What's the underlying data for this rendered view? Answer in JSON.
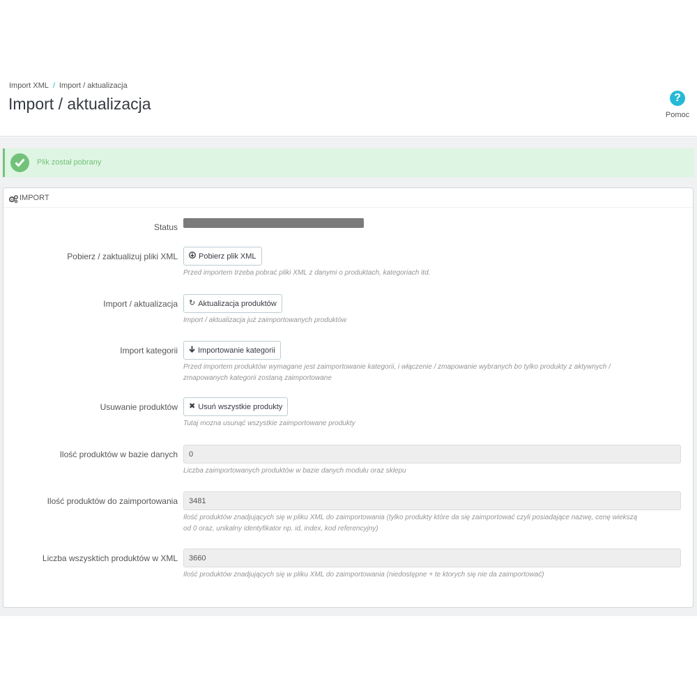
{
  "breadcrumb": {
    "items": [
      "Import XML",
      "Import / aktualizacja"
    ],
    "separator": "/"
  },
  "page_title": "Import / aktualizacja",
  "help": {
    "label": "Pomoc",
    "icon": "question-circle-icon"
  },
  "alert": {
    "text": "Plik został pobrany",
    "icon": "check-circle-icon",
    "color": "#72c279"
  },
  "panel": {
    "title": "IMPORT",
    "icon": "gears-icon",
    "status": {
      "label": "Status"
    },
    "download": {
      "label": "Pobierz / zaktualizuj pliki XML",
      "button": "Pobierz plik XML",
      "icon": "arrow-circle-down-icon",
      "help": "Przed importem trzeba pobrać pliki XML z danymi o produktach, kategoriach itd."
    },
    "update": {
      "label": "Import / aktualizacja",
      "button": "Aktualizacja produktów",
      "icon": "refresh-icon",
      "help": "Import / aktualizacja już zaimportowanych produktów"
    },
    "categories": {
      "label": "Import kategorii",
      "button": "Importowanie kategorii",
      "icon": "arrow-down-icon",
      "help_line1": "Przed importem produktów wymagane jest zaimportowanie kategorii, i włączenie / zmapowanie wybranych bo tylko produkty z aktywnych /",
      "help_line2": "zmapowanych kategorii zostaną zaimportowane"
    },
    "delete": {
      "label": "Usuwanie produktów",
      "button": "Usuń wszystkie produkty",
      "icon": "times-icon",
      "help": "Tutaj mozna usunąć wszystkie zaimportowane produkty"
    },
    "db_count": {
      "label": "Ilość produktów w bazie danych",
      "value": "0",
      "help": "Liczba zaimportowanych produktów w bazie danych modułu oraz sklepu"
    },
    "to_import": {
      "label": "Ilość produktów do zaimportowania",
      "value": "3481",
      "help_line1": "Ilość produktów znadjujących się w pliku XML do zaimportowania (tylko produkty które da się zaimportować czyli posiadające nazwę, cenę wiekszą",
      "help_line2": "od 0 oraz, unikalny identyfikator np. id, index, kod referencyjny)"
    },
    "total_xml": {
      "label": "Liczba wszysktich produktów w XML",
      "value": "3660",
      "help": "Ilość produktów znadjujących się w pliku XML do zaimportowania (niedostępne + te ktorych się nie da zaimportować)"
    }
  }
}
